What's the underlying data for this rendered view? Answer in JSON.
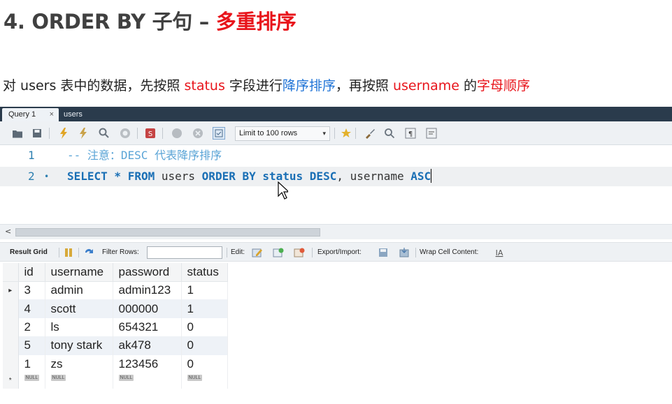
{
  "slide": {
    "title_prefix": "4. ORDER BY 子句 – ",
    "title_accent": "多重排序",
    "desc": [
      {
        "text": "对 users 表中的数据，先按照 ",
        "style": "plain"
      },
      {
        "text": "status",
        "style": "red"
      },
      {
        "text": " 字段进行",
        "style": "plain"
      },
      {
        "text": "降序排序",
        "style": "blue"
      },
      {
        "text": "，再按照 ",
        "style": "plain"
      },
      {
        "text": "username",
        "style": "red"
      },
      {
        "text": " 的",
        "style": "plain"
      },
      {
        "text": "字母顺序",
        "style": "red"
      }
    ]
  },
  "tabs": {
    "active": "Query 1",
    "close": "×",
    "inactive": "users"
  },
  "toolbar": {
    "limit_label": "Limit to 100 rows",
    "limit_arrow": "▾"
  },
  "editor": {
    "line1_num": "1",
    "line1_code": "-- 注意：DESC 代表降序排序",
    "line2_num": "2",
    "line2_dot": "•",
    "kw_select": "SELECT",
    "star": " * ",
    "kw_from": "FROM",
    "tbl": " users ",
    "kw_orderby": "ORDER BY",
    "col1": " status ",
    "kw_desc": "DESC",
    "col2": ", username ",
    "kw_asc": "ASC"
  },
  "scrollbar": {
    "left_arrow": "<"
  },
  "result_toolbar": {
    "result_grid": "Result Grid",
    "filter_rows": "Filter Rows:",
    "edit": "Edit:",
    "export_import": "Export/Import:",
    "wrap_cell": "Wrap Cell Content:"
  },
  "grid": {
    "columns": [
      "id",
      "username",
      "password",
      "status"
    ],
    "rows": [
      [
        "3",
        "admin",
        "admin123",
        "1"
      ],
      [
        "4",
        "scott",
        "000000",
        "1"
      ],
      [
        "2",
        "ls",
        "654321",
        "0"
      ],
      [
        "5",
        "tony stark",
        "ak478",
        "0"
      ],
      [
        "1",
        "zs",
        "123456",
        "0"
      ]
    ],
    "current_row_marker": "▸",
    "new_row_marker": "*",
    "null_label": "NULL"
  },
  "colors": {
    "accent_red": "#e8141b",
    "accent_blue": "#1d72d6",
    "tab_bar": "#2a3b4c",
    "keyword": "#1a6fb5"
  }
}
